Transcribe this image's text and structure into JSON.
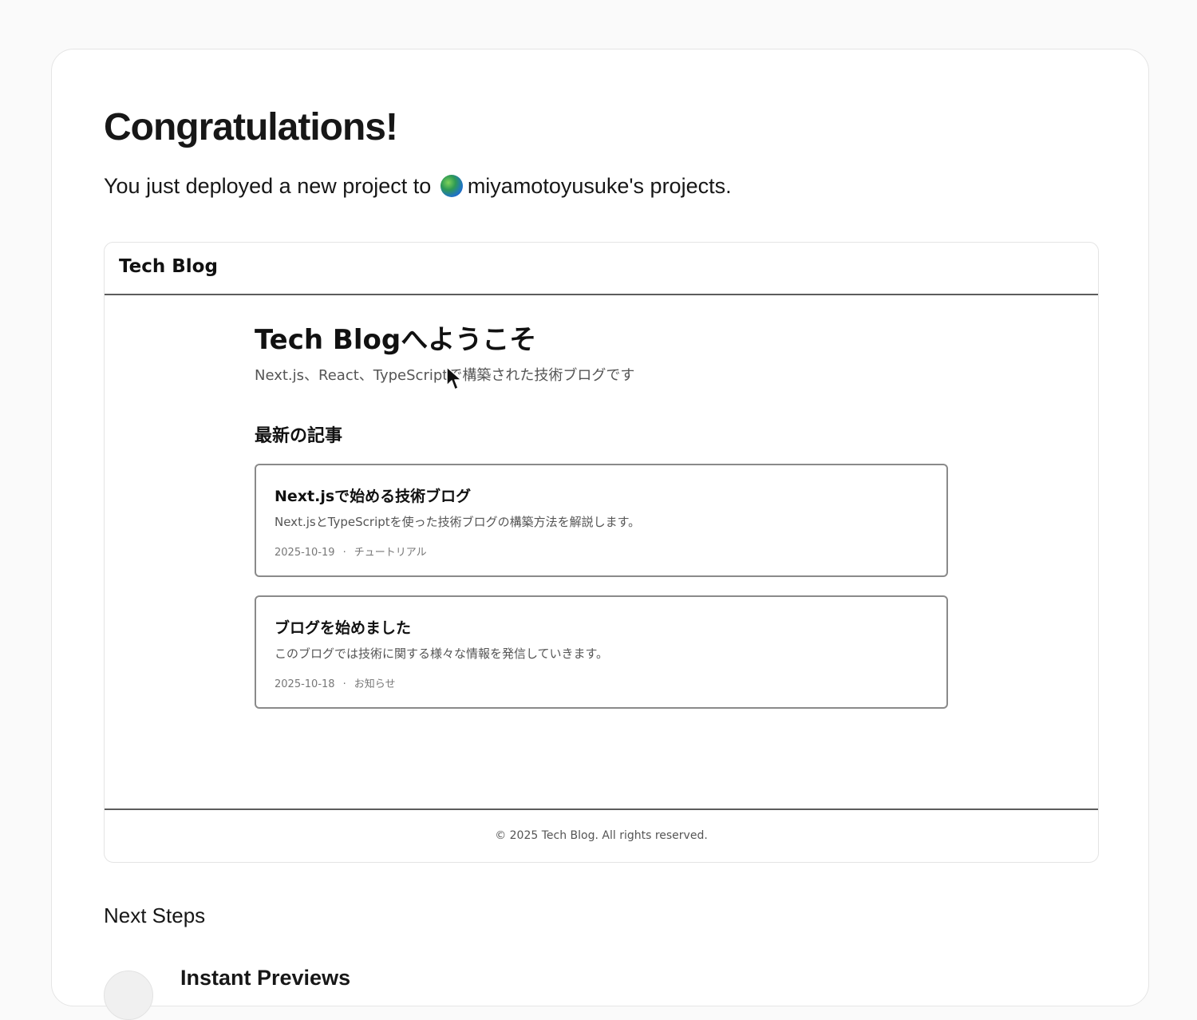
{
  "deploy": {
    "heading": "Congratulations!",
    "intro_text": "You just deployed a new project to",
    "team_name": "miyamotoyusuke's projects",
    "period": ".",
    "team_icon": "globe-avatar-icon"
  },
  "preview": {
    "brand": "Tech Blog",
    "title": "Tech Blogへようこそ",
    "description": "Next.js、React、TypeScriptで構築された技術ブログです",
    "section_title": "最新の記事",
    "posts": [
      {
        "title": "Next.jsで始める技術ブログ",
        "excerpt": "Next.jsとTypeScriptを使った技術ブログの構築方法を解説します。",
        "date": "2025-10-19",
        "separator": "·",
        "category": "チュートリアル"
      },
      {
        "title": "ブログを始めました",
        "excerpt": "このブログでは技術に関する様々な情報を発信していきます。",
        "date": "2025-10-18",
        "separator": "·",
        "category": "お知らせ"
      }
    ],
    "footer": "© 2025 Tech Blog. All rights reserved."
  },
  "next_steps": {
    "heading": "Next Steps",
    "items": [
      {
        "title": "Instant Previews"
      }
    ]
  }
}
